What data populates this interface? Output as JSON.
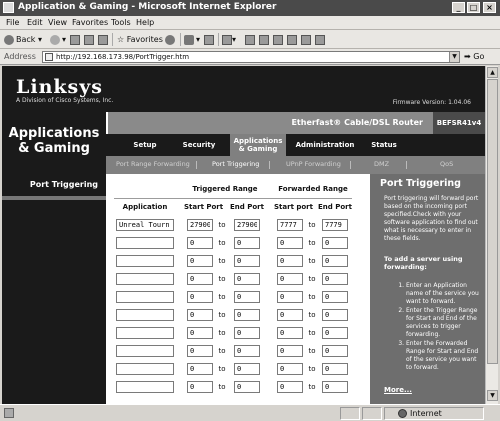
{
  "window": {
    "title": "Application & Gaming - Microsoft Internet Explorer"
  },
  "menu": [
    "File",
    "Edit",
    "View",
    "Favorites",
    "Tools",
    "Help"
  ],
  "toolbar": {
    "back": "Back",
    "favorites": "Favorites"
  },
  "address": {
    "label": "Address",
    "url": "http://192.168.173.98/PortTrigger.htm",
    "go": "Go"
  },
  "router": {
    "logo": "Linksys",
    "logo_sub": "A Division of Cisco Systems, Inc.",
    "firmware": "Firmware Version: 1.04.06",
    "section": "Applications & Gaming",
    "product": "Etherfast® Cable/DSL Router",
    "model": "BEFSR41v4",
    "tabs": [
      "Setup",
      "Security",
      "Applications & Gaming",
      "Administration",
      "Status"
    ],
    "subtabs": [
      "Port Range Forwarding",
      "Port Triggering",
      "UPnP Forwarding",
      "DMZ",
      "QoS"
    ],
    "left_item": "Port Triggering"
  },
  "table": {
    "group_triggered": "Triggered Range",
    "group_forwarded": "Forwarded Range",
    "col_application": "Application",
    "col_start_port": "Start Port",
    "col_end_port": "End Port",
    "col_start_port2": "Start port",
    "col_end_port2": "End Port",
    "to": "to",
    "rows": [
      {
        "app": "Unreal Tourn",
        "t_start": "27900",
        "t_end": "27900",
        "f_start": "7777",
        "f_end": "7779"
      },
      {
        "app": "",
        "t_start": "0",
        "t_end": "0",
        "f_start": "0",
        "f_end": "0"
      },
      {
        "app": "",
        "t_start": "0",
        "t_end": "0",
        "f_start": "0",
        "f_end": "0"
      },
      {
        "app": "",
        "t_start": "0",
        "t_end": "0",
        "f_start": "0",
        "f_end": "0"
      },
      {
        "app": "",
        "t_start": "0",
        "t_end": "0",
        "f_start": "0",
        "f_end": "0"
      },
      {
        "app": "",
        "t_start": "0",
        "t_end": "0",
        "f_start": "0",
        "f_end": "0"
      },
      {
        "app": "",
        "t_start": "0",
        "t_end": "0",
        "f_start": "0",
        "f_end": "0"
      },
      {
        "app": "",
        "t_start": "0",
        "t_end": "0",
        "f_start": "0",
        "f_end": "0"
      },
      {
        "app": "",
        "t_start": "0",
        "t_end": "0",
        "f_start": "0",
        "f_end": "0"
      },
      {
        "app": "",
        "t_start": "0",
        "t_end": "0",
        "f_start": "0",
        "f_end": "0"
      }
    ]
  },
  "help": {
    "title": "Port Triggering",
    "body": "Port triggering will forward port based on the incoming port specified.Check with your software application to find out what is necessary to enter in these fields.",
    "subtitle": "To add a server using forwarding:",
    "steps": [
      "Enter an Application name of the service you want to forward.",
      "Enter the Trigger Range for Start and End of the services to trigger forwarding.",
      "Enter the Forwarded Range for Start and End of the service you want to forward."
    ],
    "more": "More..."
  },
  "status": {
    "zone": "Internet"
  }
}
